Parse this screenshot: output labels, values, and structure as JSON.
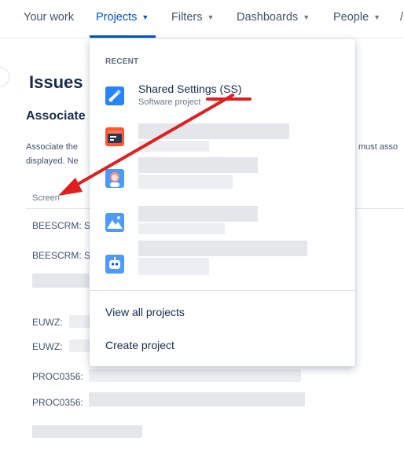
{
  "nav": {
    "your_work": "Your work",
    "projects": "Projects",
    "filters": "Filters",
    "dashboards": "Dashboards",
    "people": "People",
    "apps_partial": "/"
  },
  "colors": {
    "accent": "#0052cc",
    "annotation_red": "#e01e1e"
  },
  "page": {
    "title": "Issues",
    "section_title": "Associate",
    "desc_line1": "Associate the",
    "desc_line2": "displayed. Ne",
    "desc_right": "must asso",
    "column_header": "Screen",
    "rows": [
      "BEESCRM: S",
      "BEESCRM: S",
      "",
      "EUWZ:",
      "EUWZ:",
      "PROC0356:",
      "PROC0356:",
      ""
    ]
  },
  "dropdown": {
    "heading": "RECENT",
    "recent_projects": [
      {
        "name": "Shared Settings (SS)",
        "type": "Software project",
        "icon": "wrench-tools-icon",
        "color": "#2684ff"
      }
    ],
    "other_project_icons": [
      {
        "icon": "dev-terminal-icon",
        "color": "#ff5630"
      },
      {
        "icon": "person-avatar-icon",
        "color": "#4c9aff"
      },
      {
        "icon": "mountains-icon",
        "color": "#4c9aff"
      },
      {
        "icon": "robot-icon",
        "color": "#4c9aff"
      }
    ],
    "view_all": "View all projects",
    "create": "Create project"
  }
}
